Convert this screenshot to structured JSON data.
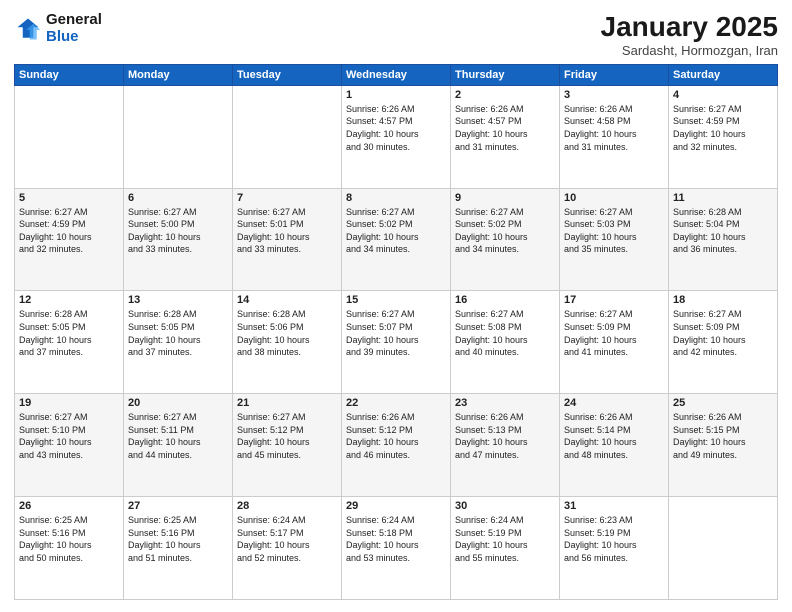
{
  "header": {
    "logo_line1": "General",
    "logo_line2": "Blue",
    "month": "January 2025",
    "location": "Sardasht, Hormozgan, Iran"
  },
  "weekdays": [
    "Sunday",
    "Monday",
    "Tuesday",
    "Wednesday",
    "Thursday",
    "Friday",
    "Saturday"
  ],
  "weeks": [
    [
      {
        "day": "",
        "info": ""
      },
      {
        "day": "",
        "info": ""
      },
      {
        "day": "",
        "info": ""
      },
      {
        "day": "1",
        "info": "Sunrise: 6:26 AM\nSunset: 4:57 PM\nDaylight: 10 hours\nand 30 minutes."
      },
      {
        "day": "2",
        "info": "Sunrise: 6:26 AM\nSunset: 4:57 PM\nDaylight: 10 hours\nand 31 minutes."
      },
      {
        "day": "3",
        "info": "Sunrise: 6:26 AM\nSunset: 4:58 PM\nDaylight: 10 hours\nand 31 minutes."
      },
      {
        "day": "4",
        "info": "Sunrise: 6:27 AM\nSunset: 4:59 PM\nDaylight: 10 hours\nand 32 minutes."
      }
    ],
    [
      {
        "day": "5",
        "info": "Sunrise: 6:27 AM\nSunset: 4:59 PM\nDaylight: 10 hours\nand 32 minutes."
      },
      {
        "day": "6",
        "info": "Sunrise: 6:27 AM\nSunset: 5:00 PM\nDaylight: 10 hours\nand 33 minutes."
      },
      {
        "day": "7",
        "info": "Sunrise: 6:27 AM\nSunset: 5:01 PM\nDaylight: 10 hours\nand 33 minutes."
      },
      {
        "day": "8",
        "info": "Sunrise: 6:27 AM\nSunset: 5:02 PM\nDaylight: 10 hours\nand 34 minutes."
      },
      {
        "day": "9",
        "info": "Sunrise: 6:27 AM\nSunset: 5:02 PM\nDaylight: 10 hours\nand 34 minutes."
      },
      {
        "day": "10",
        "info": "Sunrise: 6:27 AM\nSunset: 5:03 PM\nDaylight: 10 hours\nand 35 minutes."
      },
      {
        "day": "11",
        "info": "Sunrise: 6:28 AM\nSunset: 5:04 PM\nDaylight: 10 hours\nand 36 minutes."
      }
    ],
    [
      {
        "day": "12",
        "info": "Sunrise: 6:28 AM\nSunset: 5:05 PM\nDaylight: 10 hours\nand 37 minutes."
      },
      {
        "day": "13",
        "info": "Sunrise: 6:28 AM\nSunset: 5:05 PM\nDaylight: 10 hours\nand 37 minutes."
      },
      {
        "day": "14",
        "info": "Sunrise: 6:28 AM\nSunset: 5:06 PM\nDaylight: 10 hours\nand 38 minutes."
      },
      {
        "day": "15",
        "info": "Sunrise: 6:27 AM\nSunset: 5:07 PM\nDaylight: 10 hours\nand 39 minutes."
      },
      {
        "day": "16",
        "info": "Sunrise: 6:27 AM\nSunset: 5:08 PM\nDaylight: 10 hours\nand 40 minutes."
      },
      {
        "day": "17",
        "info": "Sunrise: 6:27 AM\nSunset: 5:09 PM\nDaylight: 10 hours\nand 41 minutes."
      },
      {
        "day": "18",
        "info": "Sunrise: 6:27 AM\nSunset: 5:09 PM\nDaylight: 10 hours\nand 42 minutes."
      }
    ],
    [
      {
        "day": "19",
        "info": "Sunrise: 6:27 AM\nSunset: 5:10 PM\nDaylight: 10 hours\nand 43 minutes."
      },
      {
        "day": "20",
        "info": "Sunrise: 6:27 AM\nSunset: 5:11 PM\nDaylight: 10 hours\nand 44 minutes."
      },
      {
        "day": "21",
        "info": "Sunrise: 6:27 AM\nSunset: 5:12 PM\nDaylight: 10 hours\nand 45 minutes."
      },
      {
        "day": "22",
        "info": "Sunrise: 6:26 AM\nSunset: 5:12 PM\nDaylight: 10 hours\nand 46 minutes."
      },
      {
        "day": "23",
        "info": "Sunrise: 6:26 AM\nSunset: 5:13 PM\nDaylight: 10 hours\nand 47 minutes."
      },
      {
        "day": "24",
        "info": "Sunrise: 6:26 AM\nSunset: 5:14 PM\nDaylight: 10 hours\nand 48 minutes."
      },
      {
        "day": "25",
        "info": "Sunrise: 6:26 AM\nSunset: 5:15 PM\nDaylight: 10 hours\nand 49 minutes."
      }
    ],
    [
      {
        "day": "26",
        "info": "Sunrise: 6:25 AM\nSunset: 5:16 PM\nDaylight: 10 hours\nand 50 minutes."
      },
      {
        "day": "27",
        "info": "Sunrise: 6:25 AM\nSunset: 5:16 PM\nDaylight: 10 hours\nand 51 minutes."
      },
      {
        "day": "28",
        "info": "Sunrise: 6:24 AM\nSunset: 5:17 PM\nDaylight: 10 hours\nand 52 minutes."
      },
      {
        "day": "29",
        "info": "Sunrise: 6:24 AM\nSunset: 5:18 PM\nDaylight: 10 hours\nand 53 minutes."
      },
      {
        "day": "30",
        "info": "Sunrise: 6:24 AM\nSunset: 5:19 PM\nDaylight: 10 hours\nand 55 minutes."
      },
      {
        "day": "31",
        "info": "Sunrise: 6:23 AM\nSunset: 5:19 PM\nDaylight: 10 hours\nand 56 minutes."
      },
      {
        "day": "",
        "info": ""
      }
    ]
  ]
}
